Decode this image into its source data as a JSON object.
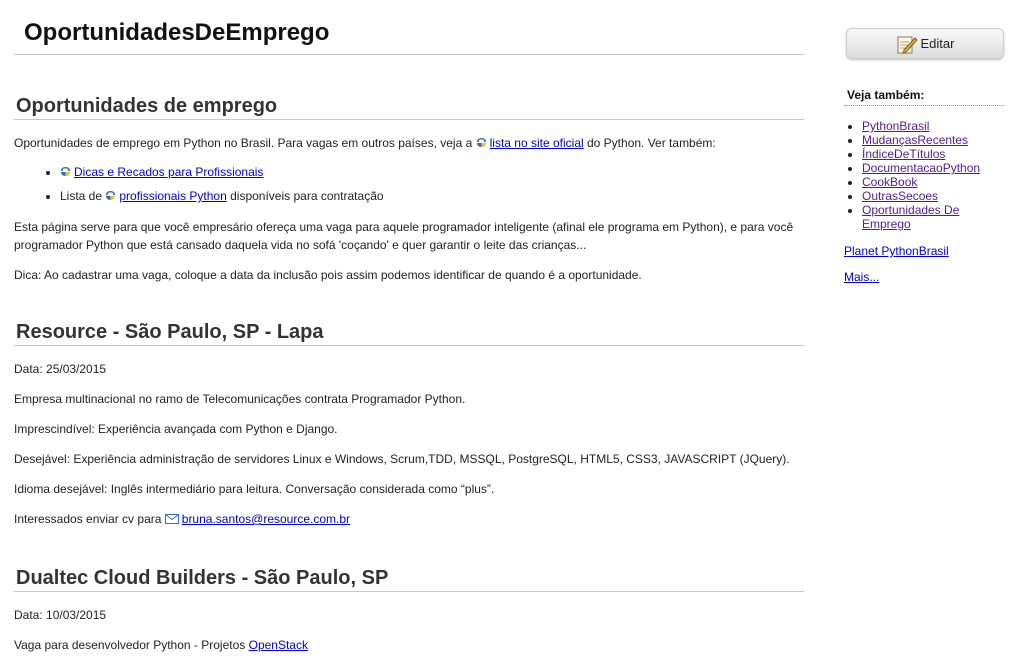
{
  "page": {
    "title": "OportunidadesDeEmprego"
  },
  "sidebar": {
    "edit_label": "Editar",
    "see_also_title": "Veja também:",
    "links": [
      "PythonBrasil",
      "MudançasRecentes",
      "ÍndiceDeTítulos",
      "DocumentacaoPython",
      "CookBook",
      "OutrasSecoes",
      "Oportunidades De Emprego"
    ],
    "planet_link": "Planet PythonBrasil",
    "more_link": "Mais..."
  },
  "intro": {
    "heading": "Oportunidades de emprego",
    "p1_before": "Oportunidades de emprego em Python no Brasil. Para vagas em outros países, veja a",
    "p1_link": "lista no site oficial",
    "p1_after": "do Python. Ver também:",
    "bullet1_link": "Dicas e Recados para Profissionais",
    "bullet2_before": "Lista de",
    "bullet2_link": "profissionais Python",
    "bullet2_after": "disponíveis para contratação",
    "p2": "Esta página serve para que você empresário ofereça uma vaga para aquele programador inteligente (afinal ele programa em Python), e para você programador Python que está cansado daquela vida no sofá 'coçando' e quer garantir o leite das crianças...",
    "p3": "Dica: Ao cadastrar uma vaga, coloque a data da inclusão pois assim podemos identificar de quando é a oportunidade."
  },
  "job1": {
    "heading": "Resource - São Paulo, SP - Lapa",
    "date": "Data: 25/03/2015",
    "p1": "Empresa multinacional no ramo de Telecomunicações contrata Programador Python.",
    "p2": "Imprescindível: Experiência avançada com Python e Django.",
    "p3": "Desejável: Experiência administração de servidores Linux e Windows, Scrum,TDD, MSSQL, PostgreSQL, HTML5, CSS3, JAVASCRIPT (JQuery).",
    "p4": "Idioma desejável: Inglês intermediário para leitura. Conversação considerada como “plus”.",
    "p5_before": "Interessados enviar cv para",
    "email": "bruna.santos@resource.com.br"
  },
  "job2": {
    "heading": "Dualtec Cloud Builders - São Paulo, SP",
    "date": "Data: 10/03/2015",
    "p1_before": "Vaga para desenvolvedor Python - Projetos",
    "p1_link": "OpenStack"
  }
}
